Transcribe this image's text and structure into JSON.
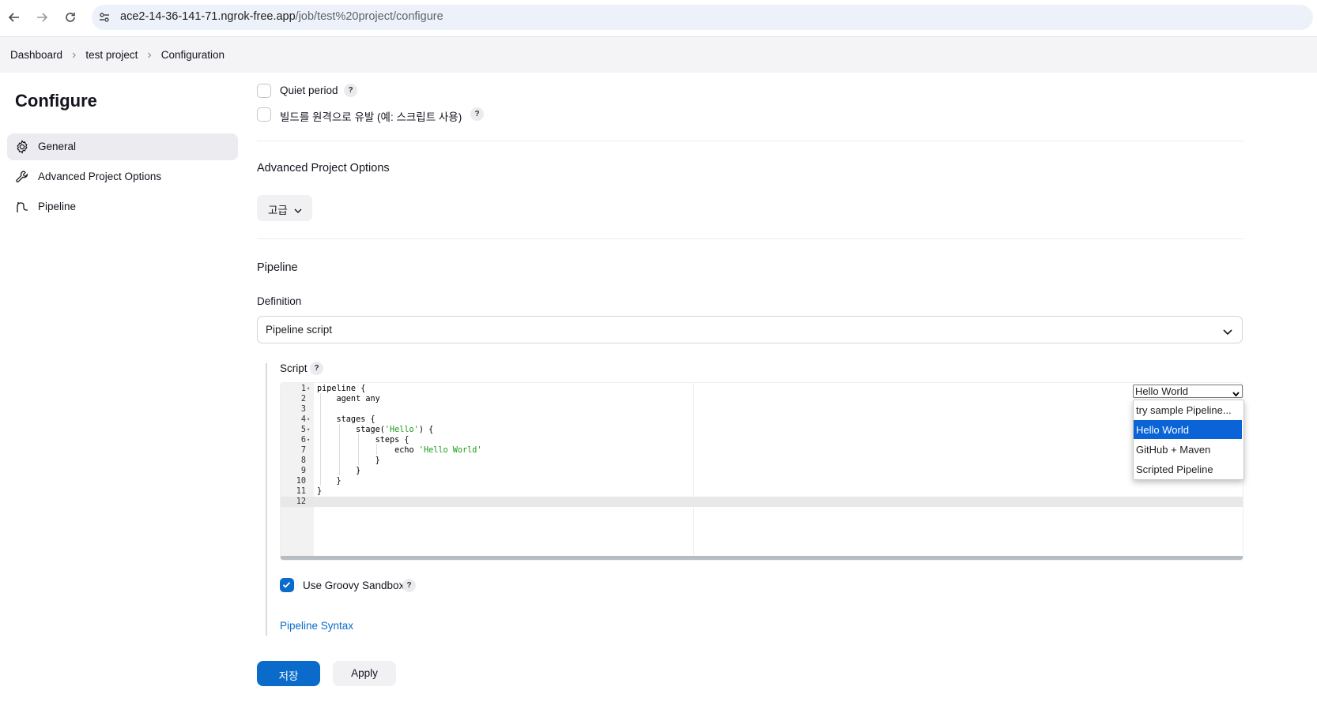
{
  "browser": {
    "url_host": "ace2-14-36-141-71.ngrok-free.app",
    "url_path": "/job/test%20project/configure"
  },
  "breadcrumb": [
    "Dashboard",
    "test project",
    "Configuration"
  ],
  "sidebar": {
    "title": "Configure",
    "items": [
      {
        "label": "General",
        "icon": "gear-icon",
        "active": true
      },
      {
        "label": "Advanced Project Options",
        "icon": "wrench-icon",
        "active": false
      },
      {
        "label": "Pipeline",
        "icon": "pipeline-icon",
        "active": false
      }
    ]
  },
  "options": {
    "quiet_period": "Quiet period",
    "trigger_remote": "빌드를 원격으로 유발 (예: 스크립트 사용)",
    "help": "?"
  },
  "advanced": {
    "title": "Advanced Project Options",
    "button": "고급"
  },
  "pipeline": {
    "title": "Pipeline",
    "definition_label": "Definition",
    "definition_value": "Pipeline script",
    "script_label": "Script",
    "sample_selected": "Hello World",
    "sample_options": [
      "try sample Pipeline...",
      "Hello World",
      "GitHub + Maven",
      "Scripted Pipeline"
    ],
    "code_lines": [
      {
        "n": "1",
        "fold": true,
        "text": "pipeline {"
      },
      {
        "n": "2",
        "fold": false,
        "text": "    agent any"
      },
      {
        "n": "3",
        "fold": false,
        "text": ""
      },
      {
        "n": "4",
        "fold": true,
        "text": "    stages {"
      },
      {
        "n": "5",
        "fold": true,
        "text": "        stage(",
        "str": "'Hello'",
        "after": ") {"
      },
      {
        "n": "6",
        "fold": true,
        "text": "            steps {"
      },
      {
        "n": "7",
        "fold": false,
        "text": "                echo ",
        "str": "'Hello World'",
        "after": ""
      },
      {
        "n": "8",
        "fold": false,
        "text": "            }"
      },
      {
        "n": "9",
        "fold": false,
        "text": "        }"
      },
      {
        "n": "10",
        "fold": false,
        "text": "    }"
      },
      {
        "n": "11",
        "fold": false,
        "text": "}"
      },
      {
        "n": "12",
        "fold": false,
        "text": ""
      }
    ],
    "sandbox_label": "Use Groovy Sandbox",
    "sandbox_checked": true,
    "syntax_link": "Pipeline Syntax"
  },
  "actions": {
    "save": "저장",
    "apply": "Apply"
  },
  "colors": {
    "primary": "#0b6bcb",
    "selected_option": "#0a64d8",
    "string": "#1a9c1a"
  }
}
